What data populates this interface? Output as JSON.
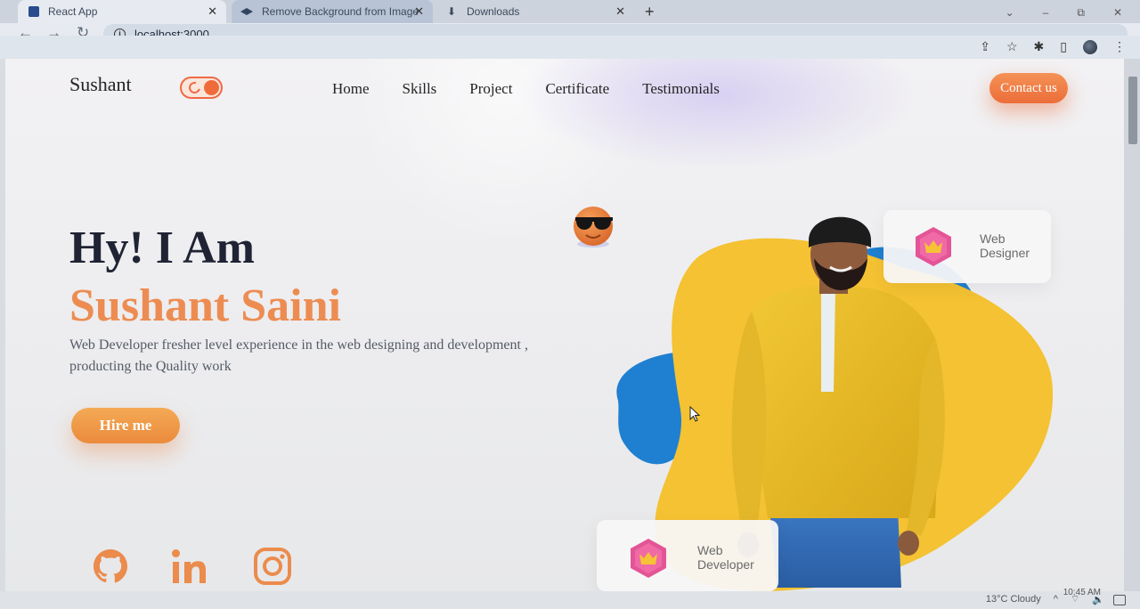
{
  "browser": {
    "tabs": [
      {
        "title": "React App",
        "active": true
      },
      {
        "title": "Remove Background from Image",
        "active": false
      },
      {
        "title": "Downloads",
        "active": false
      }
    ],
    "new_tab_label": "+",
    "address": "localhost:3000"
  },
  "site": {
    "brand": "Sushant",
    "nav": [
      "Home",
      "Skills",
      "Project",
      "Certificate",
      "Testimonials"
    ],
    "contact_label": "Contact us",
    "hero": {
      "greeting": "Hy! I Am",
      "name": "Sushant Saini",
      "description": "Web Developer fresher level experience in the web designing and development , producting the Quality work",
      "hire_label": "Hire me"
    },
    "cards": {
      "designer": "Web Designer",
      "developer": "Web Developer"
    },
    "socials": [
      "github-icon",
      "linkedin-icon",
      "instagram-icon"
    ]
  },
  "colors": {
    "accent": "#ed8c52",
    "button": "#ec6d3a",
    "dark": "#1f2333",
    "blob_yellow": "#f4c232",
    "blob_blue": "#1f7fd0"
  },
  "taskbar": {
    "weather": "13°C  Cloudy",
    "time": "10:45 AM"
  }
}
